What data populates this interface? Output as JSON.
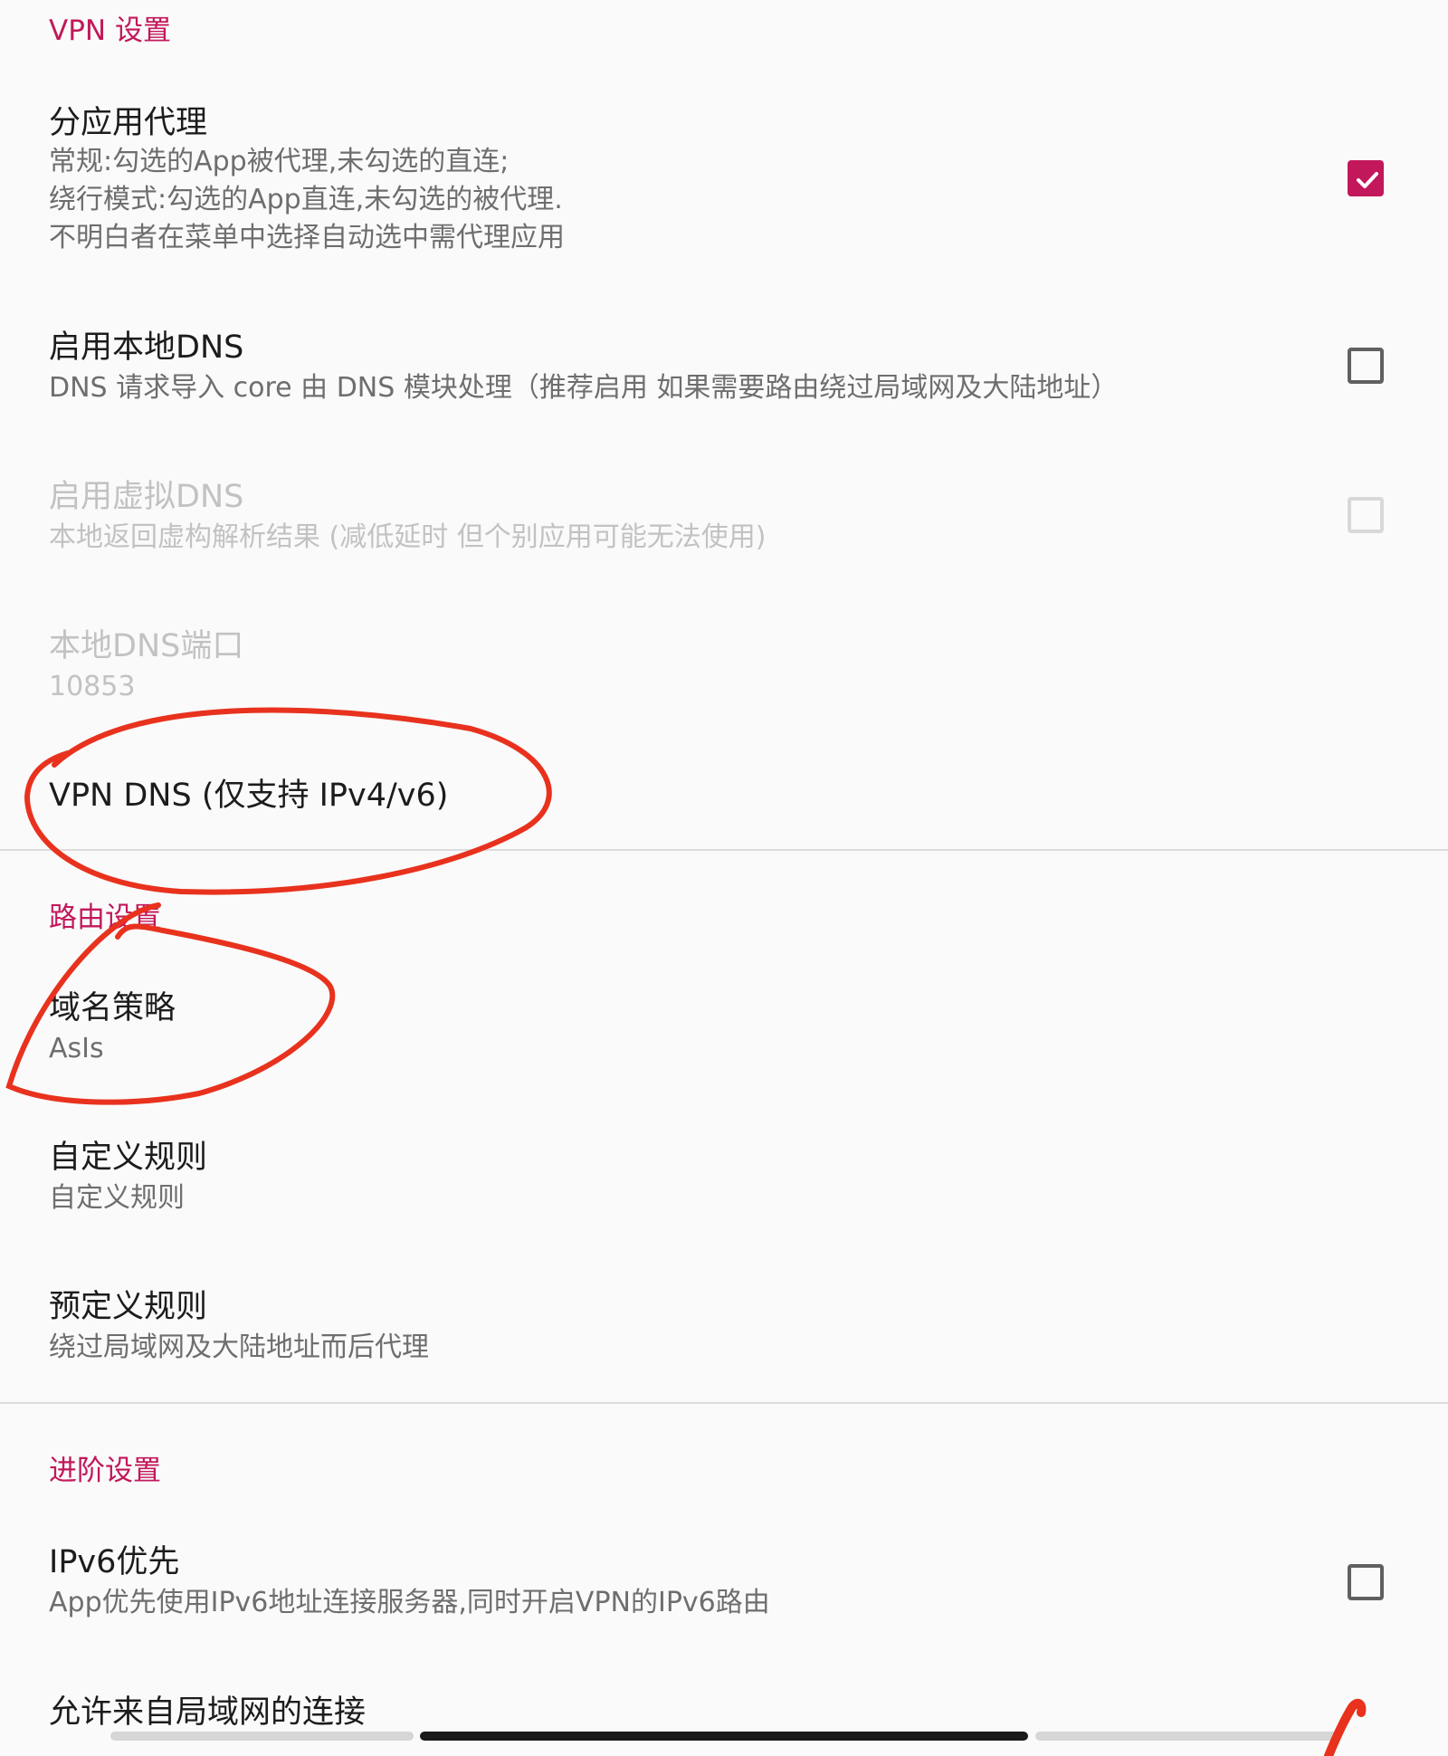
{
  "colors": {
    "accent": "#c2185b",
    "annotation": "#e8321e"
  },
  "vpn_section": {
    "header": "VPN 设置",
    "per_app_proxy": {
      "title": "分应用代理",
      "summary": "常规:勾选的App被代理,未勾选的直连;\n绕行模式:勾选的App直连,未勾选的被代理.\n不明白者在菜单中选择自动选中需代理应用",
      "checked": true
    },
    "local_dns": {
      "title": "启用本地DNS",
      "summary": "DNS 请求导入 core 由 DNS 模块处理（推荐启用 如果需要路由绕过局域网及大陆地址）",
      "checked": false
    },
    "fake_dns": {
      "title": "启用虚拟DNS",
      "summary": "本地返回虚构解析结果 (减低延时 但个别应用可能无法使用)",
      "checked": false,
      "enabled": false
    },
    "local_dns_port": {
      "title": "本地DNS端口",
      "value": "10853",
      "enabled": false
    },
    "vpn_dns": {
      "title": "VPN DNS (仅支持 IPv4/v6)"
    }
  },
  "routing_section": {
    "header": "路由设置",
    "domain_strategy": {
      "title": "域名策略",
      "value": "AsIs"
    },
    "custom_rules": {
      "title": "自定义规则",
      "summary": "自定义规则"
    },
    "predefined_rules": {
      "title": "预定义规则",
      "summary": "绕过局域网及大陆地址而后代理"
    }
  },
  "advanced_section": {
    "header": "进阶设置",
    "prefer_ipv6": {
      "title": "IPv6优先",
      "summary": "App优先使用IPv6地址连接服务器,同时开启VPN的IPv6路由",
      "checked": false
    },
    "allow_lan": {
      "title": "允许来自局域网的连接"
    }
  }
}
